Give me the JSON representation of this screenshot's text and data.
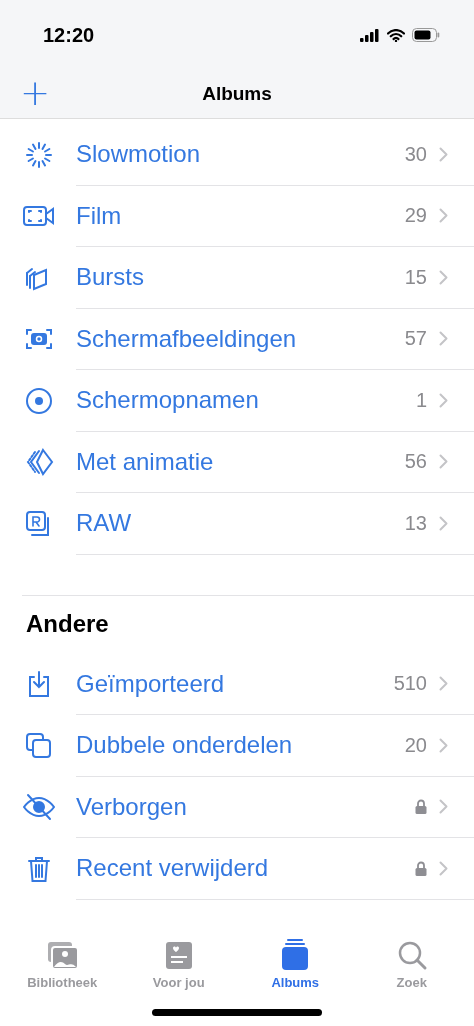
{
  "status_bar": {
    "time": "12:20"
  },
  "nav": {
    "title": "Albums",
    "add_button": "+"
  },
  "sections": [
    {
      "items": [
        {
          "label": "Slowmotion",
          "count": "30"
        },
        {
          "label": "Film",
          "count": "29"
        },
        {
          "label": "Bursts",
          "count": "15"
        },
        {
          "label": "Schermafbeeldingen",
          "count": "57"
        },
        {
          "label": "Schermopnamen",
          "count": "1"
        },
        {
          "label": "Met animatie",
          "count": "56"
        },
        {
          "label": "RAW",
          "count": "13"
        }
      ]
    },
    {
      "title": "Andere",
      "items": [
        {
          "label": "Geïmporteerd",
          "count": "510",
          "locked": false
        },
        {
          "label": "Dubbele onderdelen",
          "count": "20",
          "locked": false
        },
        {
          "label": "Verborgen",
          "locked": true
        },
        {
          "label": "Recent verwijderd",
          "locked": true
        }
      ]
    }
  ],
  "tabs": [
    {
      "label": "Bibliotheek",
      "selected": false
    },
    {
      "label": "Voor jou",
      "selected": false
    },
    {
      "label": "Albums",
      "selected": true
    },
    {
      "label": "Zoek",
      "selected": false
    }
  ]
}
